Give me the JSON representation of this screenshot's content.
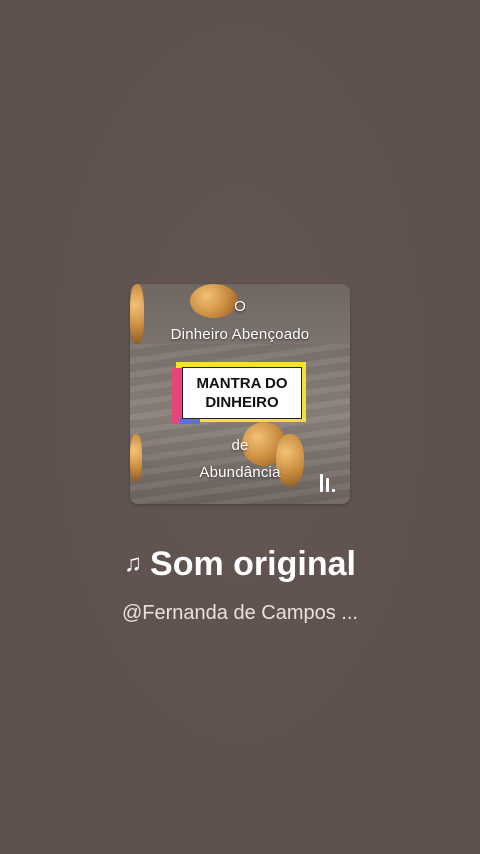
{
  "cover": {
    "line1": "O",
    "line2": "Dinheiro Abençoado",
    "badge": "MANTRA DO DINHEIRO",
    "line3": "de",
    "line4": "Abundância",
    "playing_icon": "equalizer-bars-icon"
  },
  "sound": {
    "note_icon": "♫",
    "title": "Som original",
    "author": "@Fernanda de Campos ..."
  },
  "colors": {
    "background": "#5e514e",
    "badge_yellow": "#f4df3b",
    "badge_pink": "#e7457a",
    "badge_blue": "#5a6ee0"
  }
}
